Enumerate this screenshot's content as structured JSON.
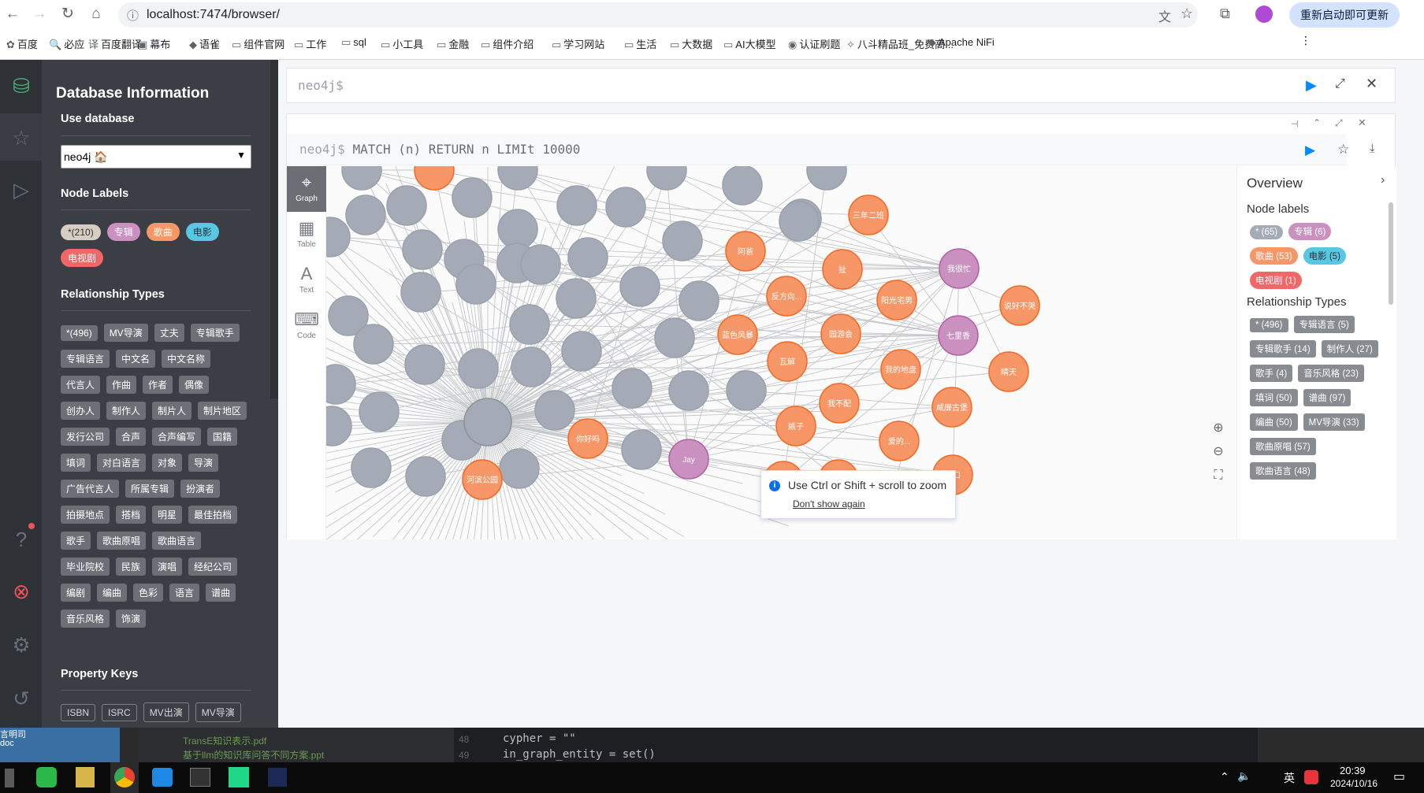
{
  "browser": {
    "url": "localhost:7474/browser/",
    "relaunch_label": "重新启动即可更新",
    "bookmarks": [
      "百度",
      "必应",
      "百度翻译",
      "幕布",
      "语雀",
      "组件官网",
      "工作",
      "sql",
      "小工具",
      "金融",
      "组件介绍",
      "学习网站",
      "生活",
      "大数据",
      "AI大模型",
      "认证刷题",
      "八斗精品班_免费高...",
      "Apache NiFi"
    ]
  },
  "drawer": {
    "title": "Database Information",
    "use_db_label": "Use database",
    "db_value": "neo4j 🏠",
    "node_labels_title": "Node Labels",
    "node_labels": [
      {
        "label": "*(210)",
        "color": "#d6cdc3",
        "text": "#333333"
      },
      {
        "label": "专辑",
        "color": "#c990c0",
        "text": "#ffffff"
      },
      {
        "label": "歌曲",
        "color": "#f79767",
        "text": "#ffffff"
      },
      {
        "label": "电影",
        "color": "#57c7e3",
        "text": "#2e3136"
      },
      {
        "label": "电视剧",
        "color": "#f16667",
        "text": "#ffffff"
      }
    ],
    "rel_types_title": "Relationship Types",
    "rel_types": [
      "*(496)",
      "MV导演",
      "丈夫",
      "专辑歌手",
      "专辑语言",
      "中文名",
      "中文名称",
      "代言人",
      "作曲",
      "作者",
      "偶像",
      "创办人",
      "制作人",
      "制片人",
      "制片地区",
      "发行公司",
      "合声",
      "合声编写",
      "国籍",
      "填词",
      "对白语言",
      "对象",
      "导演",
      "广告代言人",
      "所属专辑",
      "扮演者",
      "拍摄地点",
      "搭档",
      "明星",
      "最佳拍档",
      "歌手",
      "歌曲原唱",
      "歌曲语言",
      "毕业院校",
      "民族",
      "演唱",
      "经纪公司",
      "编剧",
      "编曲",
      "色彩",
      "语言",
      "谱曲",
      "音乐风格",
      "饰演"
    ],
    "prop_keys_title": "Property Keys",
    "prop_keys": [
      "ISBN",
      "ISRC",
      "MV出演",
      "MV导演"
    ]
  },
  "editor": {
    "prompt": "neo4j$"
  },
  "frame": {
    "prompt": "neo4j$",
    "query": "MATCH (n) RETURN n LIMIt 10000",
    "views": [
      {
        "icon": "graph-icon",
        "label": "Graph"
      },
      {
        "icon": "table-icon",
        "label": "Table"
      },
      {
        "icon": "text-icon",
        "label": "Text"
      },
      {
        "icon": "code-icon",
        "label": "Code"
      }
    ]
  },
  "overview": {
    "title": "Overview",
    "node_labels_title": "Node labels",
    "node_labels": [
      {
        "label": "* (65)",
        "color": "#a5abb6",
        "text": "#ffffff"
      },
      {
        "label": "专辑 (6)",
        "color": "#c990c0",
        "text": "#ffffff"
      },
      {
        "label": "歌曲 (53)",
        "color": "#f79767",
        "text": "#ffffff"
      },
      {
        "label": "电影 (5)",
        "color": "#57c7e3",
        "text": "#2e3136"
      },
      {
        "label": "电视剧 (1)",
        "color": "#f16667",
        "text": "#ffffff"
      }
    ],
    "rel_types_title": "Relationship Types",
    "rel_types": [
      "* (496)",
      "专辑语言 (5)",
      "专辑歌手 (14)",
      "制作人 (27)",
      "歌手 (4)",
      "音乐风格 (23)",
      "填词 (50)",
      "谱曲 (97)",
      "编曲 (50)",
      "MV导演 (33)",
      "歌曲原唱 (57)",
      "歌曲语言 (48)"
    ]
  },
  "graph": {
    "orange_nodes": [
      "三年二班",
      "阿爸",
      "扯",
      "我很忙",
      "反方向...",
      "阳光宅男",
      "蓝色风暴",
      "园游会",
      "七里香",
      "说好不哭",
      "晴天",
      "我的地盘",
      "威廉古堡",
      "我不配",
      "瓦解",
      "你好吗",
      "嫉子",
      "爱的...",
      "河滨公园",
      "借口",
      "Jay"
    ],
    "colors": {
      "gray": "#a5abb6",
      "orange": "#f79767",
      "purple": "#c990c0",
      "edge": "#c4c6c9"
    }
  },
  "tooltip": {
    "message": "Use Ctrl or Shift + scroll to zoom",
    "link": "Don't show again"
  },
  "taskbar": {
    "time": "20:39",
    "date": "2024/10/16",
    "ime": "英"
  },
  "background": {
    "files": [
      "TransE知识表示.pdf",
      "基于llm的知识库问答不同方案.ppt"
    ],
    "code_line1": "cypher = \"\"",
    "code_line2": "in_graph_entity = set()",
    "line_numbers": [
      "48",
      "49"
    ],
    "desktop_label1": "言明司",
    "desktop_label2": "doc"
  }
}
